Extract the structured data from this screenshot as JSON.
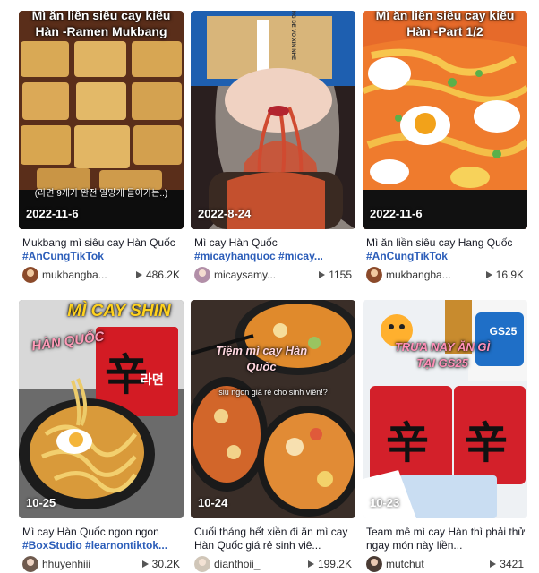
{
  "videos": [
    {
      "overlay": "Mì ăn liền siêu cay kiểu Hàn -Ramen Mukbang",
      "subtitle": "(라면 9개가 완전 일망게 들어가는..)",
      "date": "2022-11-6",
      "desc_text": "Mukbang mì siêu cay Hàn Quốc",
      "tags": [
        "#AnCungTikTok"
      ],
      "user": "mukbangba...",
      "views": "486.2K"
    },
    {
      "box_text": "HANG DE VO XIN NHE",
      "date": "2022-8-24",
      "desc_text": "Mì cay Hàn Quốc",
      "tags": [
        "#micayhanquoc",
        "#micay..."
      ],
      "user": "micaysamy...",
      "views": "1155"
    },
    {
      "overlay": "Mì ăn liền siêu cay kiểu Hàn -Part 1/2",
      "date": "2022-11-6",
      "desc_text": "Mì ăn liền siêu cay Hang Quốc",
      "tags": [
        "#AnCungTikTok"
      ],
      "user": "mukbangba...",
      "views": "16.9K"
    },
    {
      "overlay": "MÌ CAY SHIN",
      "overlay2": "HÀN QUỐC",
      "pack_text": "辛 라면",
      "date": "10-25",
      "desc_text": "Mì cay Hàn Quốc ngon ngon",
      "tags": [
        "#BoxStudio",
        "#learnontiktok..."
      ],
      "user": "hhuyenhiii",
      "views": "30.2K"
    },
    {
      "overlay": "Tiệm mì cay Hàn Quốc",
      "overlay2": "siu ngon giá rẻ cho sinh viên!?",
      "date": "10-24",
      "desc_text": "Cuối tháng hết xiền đi ăn mì cay Hàn Quốc giá rẻ sinh viê...",
      "tags": [],
      "user": "dianthoii_",
      "views": "199.2K"
    },
    {
      "overlay": "TRƯA NAY ĂN GÌ TẠI GS25",
      "sign_text": "GS25",
      "date": "10-23",
      "desc_text": "Team mê mì cay Hàn thì phải thử ngay món này liền...",
      "tags": [],
      "user": "mutchut",
      "views": "3421"
    }
  ],
  "colors": {
    "hashtag": "#2b5db9",
    "text": "#161823"
  }
}
